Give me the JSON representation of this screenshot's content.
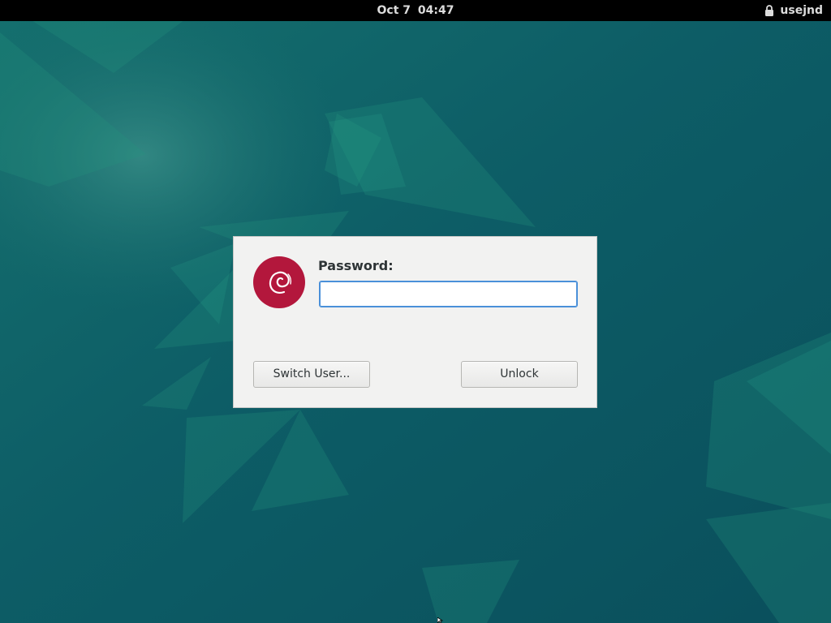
{
  "topbar": {
    "date": "Oct 7",
    "time": "04:47",
    "username": "usejnd"
  },
  "lock_dialog": {
    "logo": "debian-swirl-logo",
    "prompt_label": "Password:",
    "password_value": "",
    "switch_user_label": "Switch User...",
    "unlock_label": "Unlock"
  },
  "colors": {
    "desktop_background": "#0e5a62",
    "logo_red": "#b3173c",
    "focus_blue": "#4a90d9",
    "dialog_background": "#f2f2f1"
  },
  "icons": [
    "lock-icon",
    "debian-logo-icon",
    "mouse-pointer-icon"
  ]
}
